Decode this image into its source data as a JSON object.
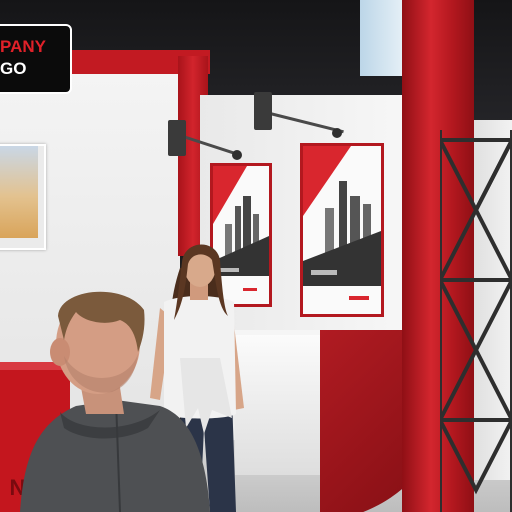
{
  "scene": {
    "sign": {
      "line1": "PANY",
      "line2": "GO"
    },
    "desk_text": "NY"
  },
  "colors": {
    "brand_red": "#c21a22",
    "wall": "#f0f0f0",
    "dark": "#1c1c1e"
  },
  "icons": [
    "ceiling-spotlight",
    "ceiling-spotlight"
  ]
}
